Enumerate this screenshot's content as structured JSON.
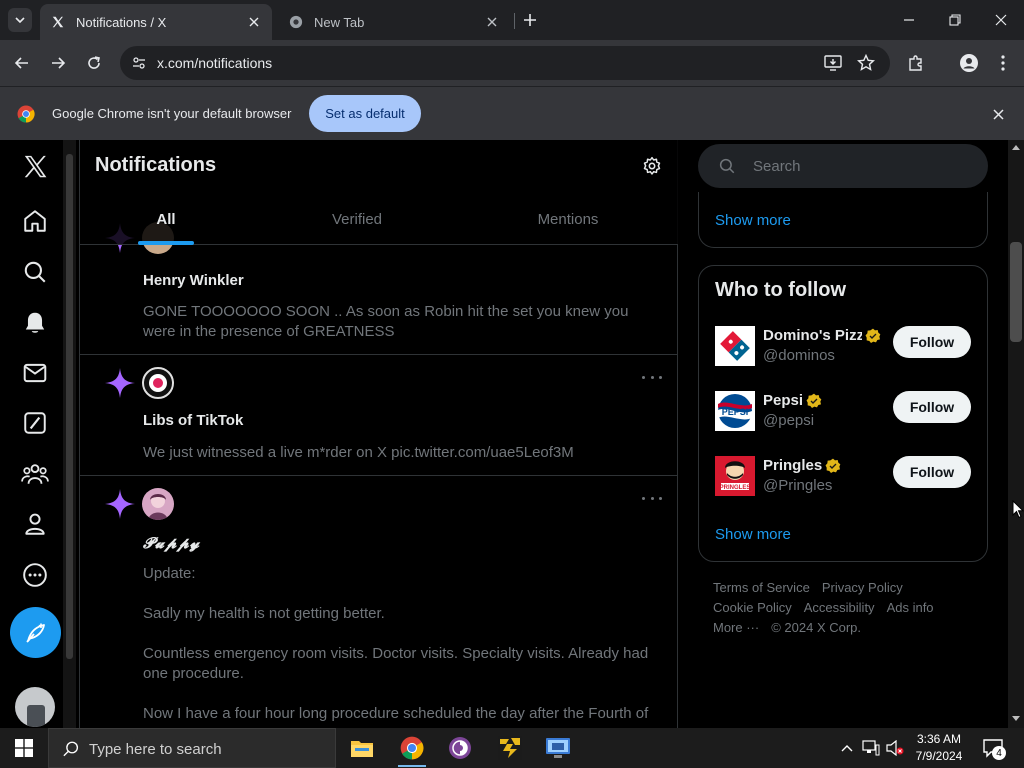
{
  "browser": {
    "tabs": [
      {
        "title": "Notifications / X",
        "active": true
      },
      {
        "title": "New Tab",
        "active": false
      }
    ],
    "url": "x.com/notifications",
    "infobar": {
      "message": "Google Chrome isn't your default browser",
      "button_label": "Set as default"
    }
  },
  "x_app": {
    "nav_icons": [
      "x-logo-icon",
      "home-icon",
      "explore-icon",
      "notifications-bell-icon",
      "messages-mail-icon",
      "grok-icon",
      "communities-icon",
      "profile-icon",
      "more-circle-icon",
      "post-compose-icon"
    ],
    "page_title": "Notifications",
    "tabs": [
      "All",
      "Verified",
      "Mentions"
    ],
    "active_tab": "All",
    "notifications": [
      {
        "name": "Henry Winkler",
        "text": "GONE TOOOOOOO SOON .. As soon as Robin hit the set you knew you were in the presence of GREATNESS"
      },
      {
        "name": "Libs of TikTok",
        "text": "We just witnessed a live m*rder on X pic.twitter.com/uae5Leof3M"
      },
      {
        "name": "𝓟𝓾𝓹𝓹𝔂",
        "lines": [
          "Update:",
          "Sadly my health is not getting better.",
          "Countless emergency room visits. Doctor visits. Specialty visits. Already had one procedure.",
          "Now I have a four hour long procedure scheduled the day after the Fourth of"
        ]
      }
    ],
    "right": {
      "search_placeholder": "Search",
      "show_more_top": "Show more",
      "who_to_follow_title": "Who to follow",
      "accounts": [
        {
          "name": "Domino's Pizza",
          "handle": "@dominos",
          "button": "Follow",
          "verified": "gold"
        },
        {
          "name": "Pepsi",
          "handle": "@pepsi",
          "button": "Follow",
          "verified": "gold"
        },
        {
          "name": "Pringles",
          "handle": "@Pringles",
          "button": "Follow",
          "verified": "gold"
        }
      ],
      "show_more_bottom": "Show more",
      "footer": [
        "Terms of Service",
        "Privacy Policy",
        "Cookie Policy",
        "Accessibility",
        "Ads info",
        "More ···",
        "© 2024 X Corp."
      ]
    }
  },
  "taskbar": {
    "search_placeholder": "Type here to search",
    "apps": [
      "file-explorer-icon",
      "chrome-icon",
      "tor-browser-icon",
      "game-app-icon",
      "remote-desktop-icon"
    ],
    "time": "3:36 AM",
    "date": "7/9/2024",
    "notification_count": "4"
  },
  "colors": {
    "x_blue": "#1d9bf0",
    "verified_gold": "#e2b719",
    "spark_purple": "#a566ff",
    "chrome_button": "#a8c7fa"
  }
}
